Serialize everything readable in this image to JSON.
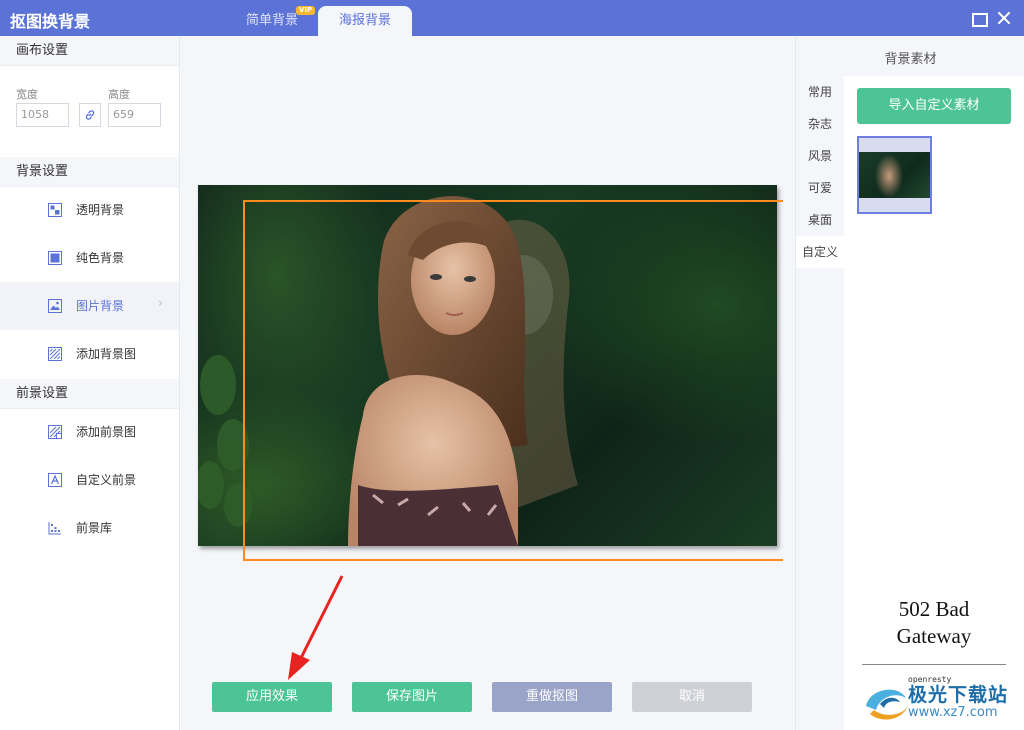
{
  "app_title": "抠图换背景",
  "tabs": [
    {
      "label": "简单背景",
      "badge": "VIP"
    },
    {
      "label": "海报背景"
    }
  ],
  "left": {
    "canvas_section": "画布设置",
    "width_label": "宽度",
    "width_value": "1058",
    "height_label": "高度",
    "height_value": "659",
    "bg_section": "背景设置",
    "bg_items": [
      {
        "label": "透明背景"
      },
      {
        "label": "纯色背景"
      },
      {
        "label": "图片背景"
      },
      {
        "label": "添加背景图"
      }
    ],
    "fg_section": "前景设置",
    "fg_items": [
      {
        "label": "添加前景图"
      },
      {
        "label": "自定义前景"
      },
      {
        "label": "前景库"
      }
    ]
  },
  "buttons": {
    "apply": "应用效果",
    "save": "保存图片",
    "redo": "重做抠图",
    "cancel": "取消"
  },
  "right": {
    "title": "背景素材",
    "categories": [
      "常用",
      "杂志",
      "风景",
      "可爱",
      "桌面",
      "自定义"
    ],
    "active_category": "自定义",
    "import_button": "导入自定义素材"
  },
  "overlay": {
    "error_text": "502 Bad Gateway",
    "server": "openresty",
    "watermark_title": "极光下载站",
    "watermark_url": "www.xz7.com"
  },
  "colors": {
    "titlebar": "#5b72d6",
    "accent_green": "#4cc495",
    "frame_orange": "#ff8a1d",
    "arrow_red": "#e8231f"
  }
}
